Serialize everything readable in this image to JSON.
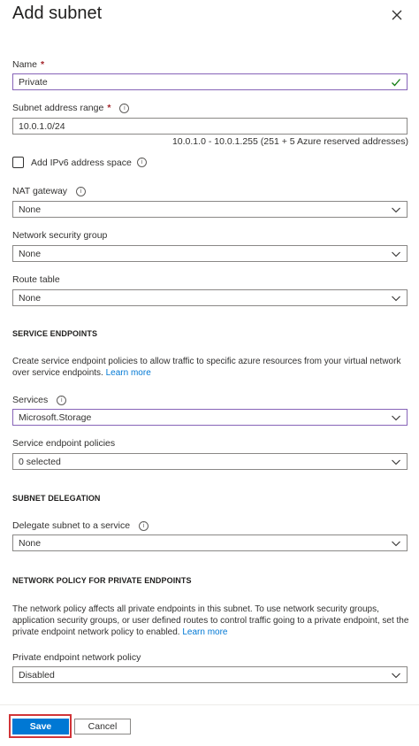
{
  "panel": {
    "title": "Add subnet"
  },
  "name": {
    "label": "Name",
    "required": "*",
    "value": "Private"
  },
  "address": {
    "label": "Subnet address range",
    "required": "*",
    "value": "10.0.1.0/24",
    "hint": "10.0.1.0 - 10.0.1.255 (251 + 5 Azure reserved addresses)"
  },
  "ipv6": {
    "label": "Add IPv6 address space",
    "checked": false
  },
  "nat": {
    "label": "NAT gateway",
    "value": "None"
  },
  "nsg": {
    "label": "Network security group",
    "value": "None"
  },
  "route": {
    "label": "Route table",
    "value": "None"
  },
  "service_endpoints": {
    "heading": "SERVICE ENDPOINTS",
    "description": "Create service endpoint policies to allow traffic to specific azure resources from your virtual network over service endpoints.",
    "learn_more": "Learn more",
    "services_label": "Services",
    "services_value": "Microsoft.Storage",
    "policies_label": "Service endpoint policies",
    "policies_value": "0 selected"
  },
  "delegation": {
    "heading": "SUBNET DELEGATION",
    "label": "Delegate subnet to a service",
    "value": "None"
  },
  "private_endpoints": {
    "heading": "NETWORK POLICY FOR PRIVATE ENDPOINTS",
    "description": "The network policy affects all private endpoints in this subnet. To use network security groups, application security groups, or user defined routes to control traffic going to a private endpoint, set the private endpoint network policy to enabled.",
    "learn_more": "Learn more",
    "label": "Private endpoint network policy",
    "value": "Disabled"
  },
  "footer": {
    "save": "Save",
    "cancel": "Cancel"
  },
  "icons": {
    "close": "close-icon",
    "info": "info-icon",
    "chevron": "chevron-down-icon",
    "check": "checkmark-icon"
  },
  "colors": {
    "accent": "#0078d4",
    "focus_border": "#8764b8",
    "highlight_outline": "#d13438",
    "check": "#107c10"
  }
}
